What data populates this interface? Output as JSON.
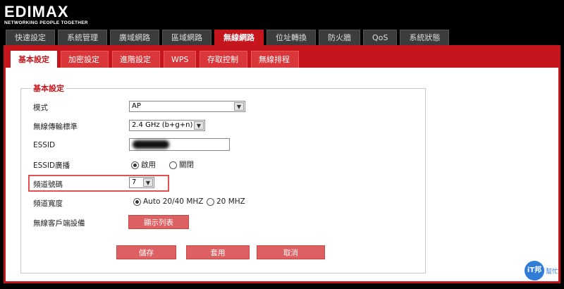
{
  "brand": {
    "logo": "EDIMAX",
    "tagline": "NETWORKING PEOPLE TOGETHER"
  },
  "main_tabs": [
    "快速設定",
    "系統管理",
    "廣域網路",
    "區域網路",
    "無線網路",
    "位址轉換",
    "防火牆",
    "QoS",
    "系統狀態"
  ],
  "sub_tabs": [
    "基本設定",
    "加密設定",
    "進階設定",
    "WPS",
    "存取控制",
    "無線排程"
  ],
  "section": {
    "title": "基本設定"
  },
  "fields": {
    "mode_label": "模式",
    "mode_value": "AP",
    "standard_label": "無線傳輸標準",
    "standard_value": "2.4 GHz (b+g+n)",
    "essid_label": "ESSID",
    "broadcast_label": "ESSID廣播",
    "broadcast_on": "啟用",
    "broadcast_off": "關閉",
    "channel_label": "頻道號碼",
    "channel_value": "7",
    "width_label": "頻道寬度",
    "width_opt1": "Auto 20/40 MHZ",
    "width_opt2": "20 MHZ",
    "client_label": "無線客戶端設備",
    "client_button": "顯示列表"
  },
  "actions": {
    "save": "儲存",
    "apply": "套用",
    "cancel": "取消"
  },
  "watermark": {
    "badge": "iT邦",
    "text": "幫忙"
  }
}
